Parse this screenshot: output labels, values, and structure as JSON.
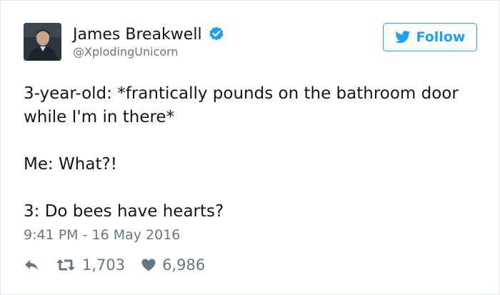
{
  "author": {
    "name": "James Breakwell",
    "handle": "@XplodingUnicorn",
    "avatar_icon": "profile-photo",
    "verified": true
  },
  "follow_button": {
    "label": "Follow",
    "icon": "twitter-bird-icon"
  },
  "tweet": {
    "lines": [
      "3-year-old: *frantically pounds on the bathroom door",
      "while I'm in there*",
      "Me: What?!",
      "3: Do bees have hearts?"
    ],
    "timestamp": "9:41 PM - 16 May 2016"
  },
  "actions": {
    "reply_icon": "reply-icon",
    "retweet_count": "1,703",
    "like_count": "6,986"
  },
  "colors": {
    "accent": "#1da1f2",
    "text": "#14171a",
    "muted": "#657786",
    "border": "#e1e8ed"
  }
}
